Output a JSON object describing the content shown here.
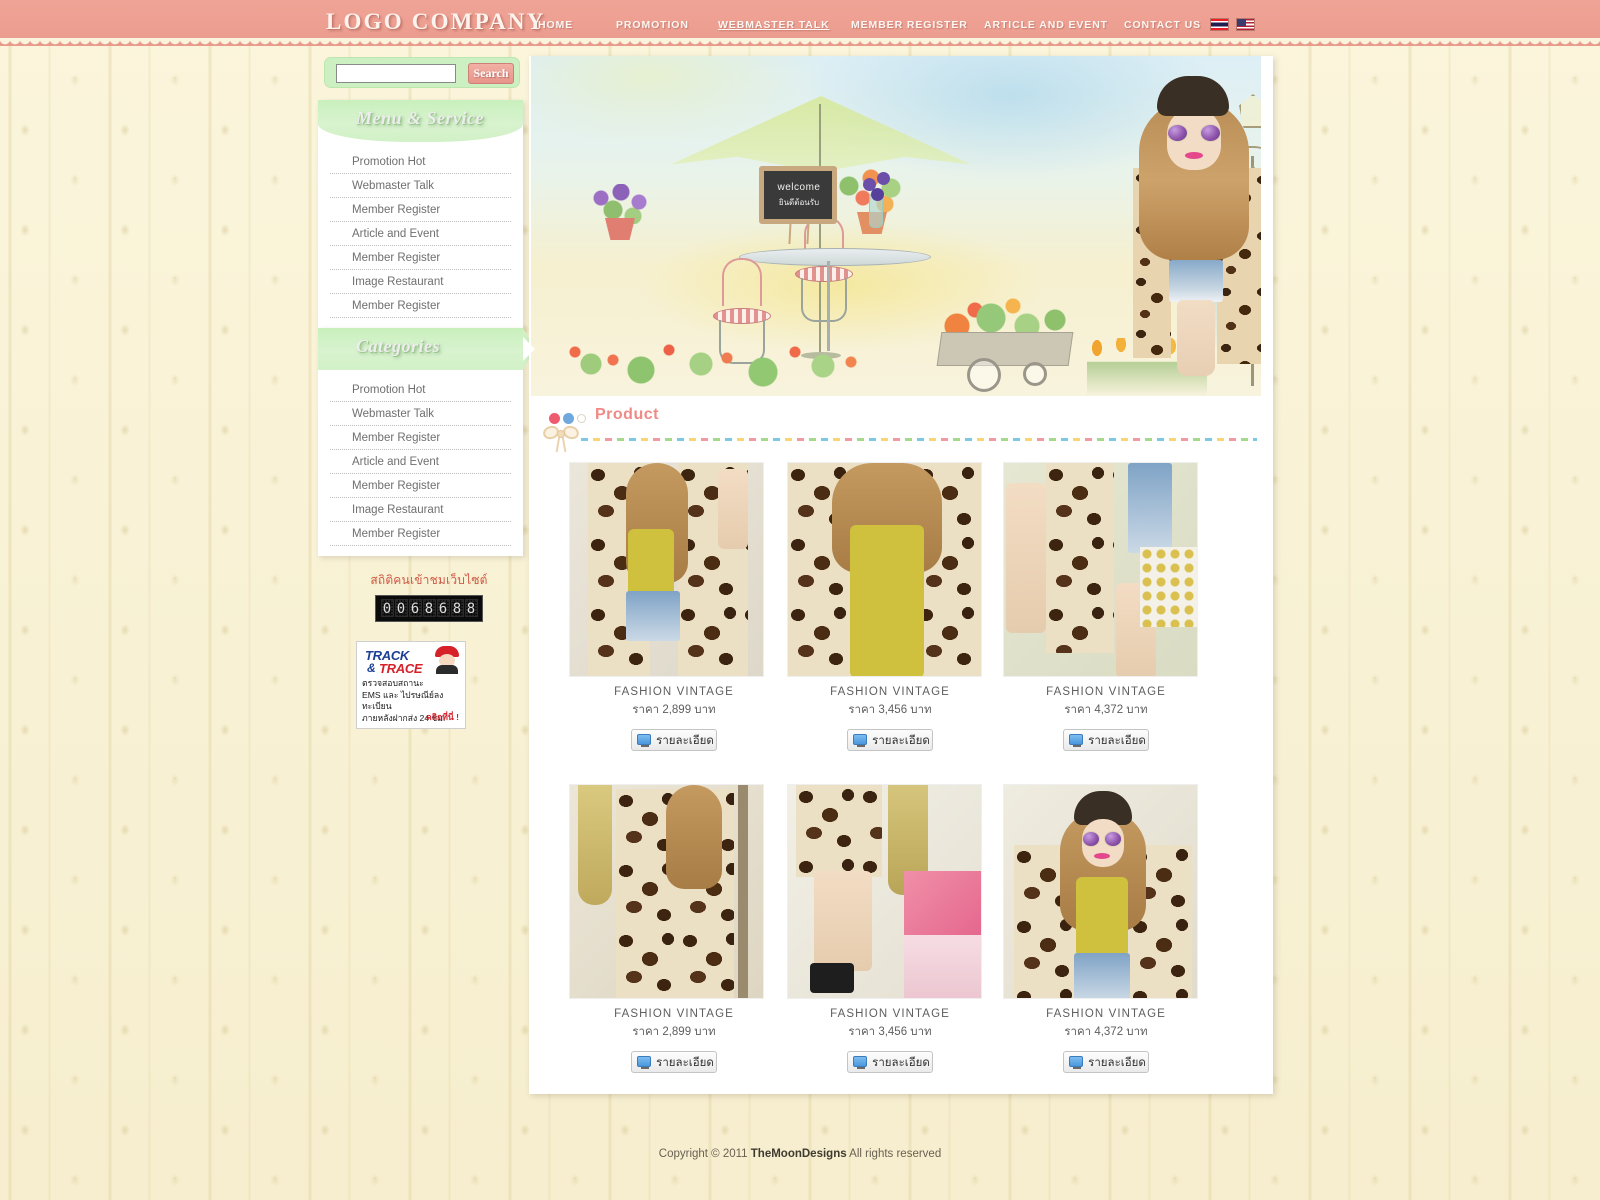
{
  "header": {
    "logo": "LOGO COMPANY",
    "nav": [
      {
        "label": "HOME",
        "active": false
      },
      {
        "label": "PROMOTION",
        "active": false
      },
      {
        "label": "WEBMASTER TALK",
        "active": true
      },
      {
        "label": "MEMBER REGISTER",
        "active": false
      },
      {
        "label": "ARTICLE AND EVENT",
        "active": false
      },
      {
        "label": "CONTACT US",
        "active": false
      }
    ],
    "flags": [
      {
        "name": "flag-thailand",
        "code": "TH"
      },
      {
        "name": "flag-usa",
        "code": "US"
      }
    ],
    "brand_color": "#eda092"
  },
  "search": {
    "value": "",
    "placeholder": "",
    "button_label": "Search"
  },
  "sidebar": {
    "menu_panel": {
      "title": "Menu & Service",
      "items": [
        {
          "label": "Promotion Hot"
        },
        {
          "label": "Webmaster Talk"
        },
        {
          "label": "Member Register"
        },
        {
          "label": "Article and Event"
        },
        {
          "label": "Member Register"
        },
        {
          "label": "Image Restaurant"
        },
        {
          "label": "Member Register"
        }
      ]
    },
    "categories_panel": {
      "title": "Categories",
      "items": [
        {
          "label": "Promotion Hot"
        },
        {
          "label": "Webmaster Talk"
        },
        {
          "label": "Member Register"
        },
        {
          "label": "Article and Event"
        },
        {
          "label": "Member Register"
        },
        {
          "label": "Image Restaurant"
        },
        {
          "label": "Member Register"
        }
      ]
    },
    "stats": {
      "label": "สถิติคนเข้าชมเว็บไซต์",
      "counter": "0068688"
    },
    "track_trace": {
      "track": "TRACK",
      "amp": "&",
      "trace": "TRACE",
      "line1": "ตรวจสอบสถานะ",
      "line2": "EMS และ ไปรษณีย์ลงทะเบียน",
      "line3": "ภายหลังฝากส่ง 24 ชม.",
      "click": "คลิกที่นี่ !"
    }
  },
  "banner": {
    "chalkboard_en": "welcome",
    "chalkboard_th": "ยินดีต้อนรับ"
  },
  "main": {
    "section_title": "Product",
    "detail_button_label": "รายละเอียด",
    "products": [
      {
        "name": "FASHION  VINTAGE",
        "price": "ราคา 2,899 บาท"
      },
      {
        "name": "FASHION  VINTAGE",
        "price": "ราคา 3,456 บาท"
      },
      {
        "name": "FASHION  VINTAGE",
        "price": "ราคา 4,372 บาท"
      },
      {
        "name": "FASHION  VINTAGE",
        "price": "ราคา 2,899 บาท"
      },
      {
        "name": "FASHION  VINTAGE",
        "price": "ราคา 3,456 บาท"
      },
      {
        "name": "FASHION  VINTAGE",
        "price": "ราคา 4,372 บาท"
      }
    ]
  },
  "footer": {
    "prefix": "Copyright © 2011 ",
    "brand": "TheMoonDesigns",
    "suffix": " All rights reserved"
  }
}
